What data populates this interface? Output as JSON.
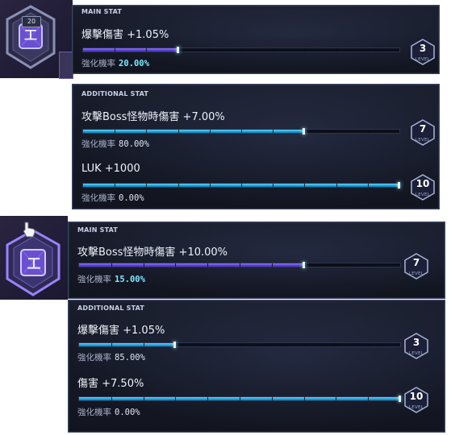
{
  "panels": [
    {
      "emblem": {
        "level_badge": "20",
        "icon": "rune-emblem-icon"
      },
      "main": {
        "header": "MAIN STAT",
        "stat": "爆擊傷害 +1.05%",
        "chance_label": "強化機率",
        "chance_value": "20.00%",
        "bar_fill": 0.3,
        "level": "3",
        "level_label": "LEVEL"
      },
      "additional": {
        "header": "ADDITIONAL STAT",
        "stats": [
          {
            "stat": "攻擊Boss怪物時傷害 +7.00%",
            "chance_label": "強化機率",
            "chance_value": "80.00%",
            "bar_fill": 0.7,
            "level": "7",
            "level_label": "LEVEL"
          },
          {
            "stat": "LUK +1000",
            "chance_label": "強化機率",
            "chance_value": "0.00%",
            "bar_fill": 1.0,
            "level": "10",
            "level_label": "LEVEL"
          }
        ]
      }
    },
    {
      "emblem": {
        "icon": "rune-emblem-icon",
        "cursor": "pointer-hand-icon"
      },
      "main": {
        "header": "MAIN STAT",
        "stat": "攻擊Boss怪物時傷害 +10.00%",
        "chance_label": "強化機率",
        "chance_value": "15.00%",
        "bar_fill": 0.7,
        "level": "7",
        "level_label": "LEVEL"
      },
      "additional": {
        "header": "ADDITIONAL STAT",
        "stats": [
          {
            "stat": "爆擊傷害 +1.05%",
            "chance_label": "強化機率",
            "chance_value": "85.00%",
            "bar_fill": 0.3,
            "level": "3",
            "level_label": "LEVEL"
          },
          {
            "stat": "傷害 +7.50%",
            "chance_label": "強化機率",
            "chance_value": "0.00%",
            "bar_fill": 1.0,
            "level": "10",
            "level_label": "LEVEL"
          }
        ]
      }
    }
  ],
  "colors": {
    "main_bar": "#6b4fe6",
    "additional_bar": "#1aa0d8",
    "accent_value": "#7fe7ff"
  }
}
